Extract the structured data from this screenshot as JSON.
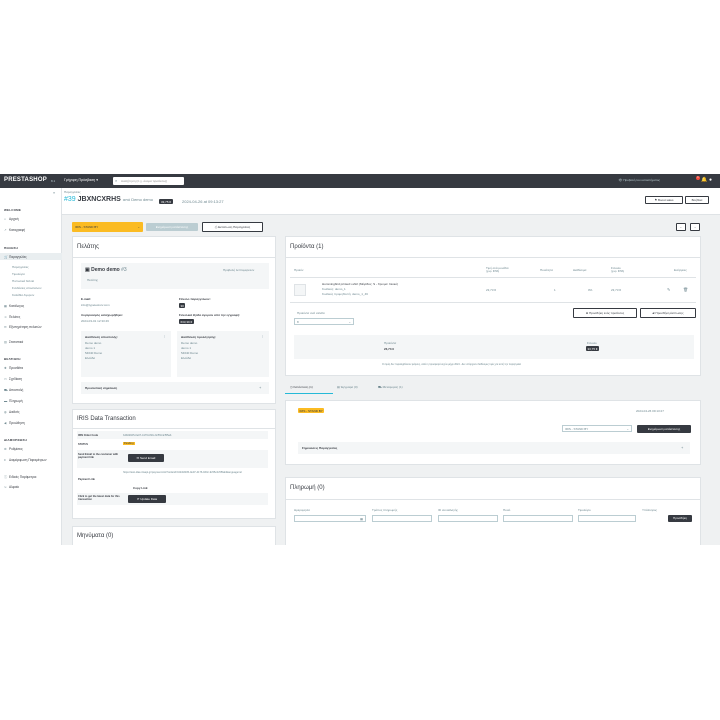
{
  "topbar": {
    "logo": "PRESTASHOP",
    "version": "8.1",
    "quick_access": "Γρήγορη Πρόσβαση ▾",
    "search_placeholder": "Αναζήτηση (π.χ. όνομα προϊόντος)",
    "view_shop": "Προβολή του καταστήματος",
    "notif_count": "1"
  },
  "sidebar": {
    "welcome_section": "WELCOME",
    "home": "Αρχική",
    "dashboard": "Καταγραφή",
    "sales_section": "ΠΩΛΗΣΗ",
    "orders": "Παραγγελίες",
    "orders_sub": [
      "Παραγγελίες",
      "Τιμολόγια",
      "Πιστωτικά δελτία",
      "Συνδέσεις αποστολών",
      "Καλάθια Αγορών"
    ],
    "catalog": "Κατάλογος",
    "customers": "Πελάτες",
    "support": "Εξυπηρέτηση πελατών",
    "stats": "Στατιστικά",
    "improve_section": "ΒΕΛΤΙΩΣΗ",
    "modules": "Προσθέτα",
    "design": "Σχεδίαση",
    "shipping": "Αποστολή",
    "payment": "Πληρωμή",
    "international": "Διεθνές",
    "marketing": "Προώθηση",
    "config_section": "ΔΙΑΜΟΡΦΩΣΗ",
    "settings": "Ρυθμίσεις",
    "shop_params": "Διαμόρφωση Παραμέτρων",
    "advanced": "Ειδικές Παράμετροι",
    "logout": "Αλφαίο"
  },
  "header": {
    "breadcrumb": "Παραγγελίες",
    "order_id": "#39",
    "order_ref": "JBXNCXRHS",
    "from": "από Demo demo",
    "total": "33,75 €",
    "date": "2024-04-26 at 09:13:27",
    "boost_sales": "Boost sales",
    "help": "Βοήθεια"
  },
  "actions": {
    "status_select": "IRIS - STAND BY",
    "update_status": "Ενημέρωση κατάστασης",
    "print_order": "Εκτύπωση Παραγγελίας"
  },
  "customer": {
    "title": "Πελάτης",
    "name": "Demo demo",
    "id": "#3",
    "view_profile": "Προβολή λεπτομερειών",
    "guest_label": "Πελάτης",
    "email_label": "E-mail:",
    "email": "info@typetestsrv.com",
    "validated_orders_label": "Σύνολο παραγγελιών:",
    "validated_orders": "30",
    "account_registered_label": "Λογαριασμός καταχωρήθηκε:",
    "account_registered": "2024-03-01 12:33:46",
    "total_spent_label": "Συνολικά έξοδα αγορών από την εγγραφή:",
    "total_spent": "633,39 €",
    "shipping_address_title": "Διεύθυνση αποστολής:",
    "shipping_address": [
      "Demo demo",
      "demo 1",
      "54640 Demo",
      "Ελλάδα"
    ],
    "invoice_address_title": "Διεύθυνση τιμολόγησης:",
    "invoice_address": [
      "Demo demo",
      "demo 1",
      "54640 Demo",
      "Ελλάδα"
    ],
    "private_note": "Προσωπική σημείωση"
  },
  "iris": {
    "title": "IRIS Data Transaction",
    "rows": [
      {
        "label": "IRIS Order Code",
        "value": "b4b02b05-0e07-4176-b60c-9c55c4c5f5ab"
      },
      {
        "label": "STATUS",
        "value": "Pending"
      },
      {
        "label": "Send Email to the customer with payment link",
        "value": "Send Email"
      },
      {
        "label": "Payment Link",
        "value": "https://test-dias.irisapi.gr/payment-link?orderid=b4b02b05-0e07-4176-b60c-9c55c4c5f5ab&language=el"
      },
      {
        "label": "Click to get the latest data for this transaction",
        "value": "Update Data"
      }
    ],
    "copy_link": "Copy Link"
  },
  "messages": {
    "title": "Μηνύματα (0)"
  },
  "products": {
    "title": "Προϊόντα (1)",
    "columns": [
      "Προϊόν",
      "Τιμή ανά μονάδα",
      "Ποσότητα",
      "Διαθέσιμα",
      "Σύνολο",
      "Ενέργειες"
    ],
    "col_sub": [
      "",
      "(χωρ. ΦΠΑ)",
      "",
      "",
      "(χωρ. ΦΠΑ)",
      ""
    ],
    "rows": [
      {
        "name": "Hummingbird printed t-shirt (Μέγεθος: S - Χρώμα: Λευκό)",
        "ref": "Κωδικός: demo_1",
        "supplier_ref": "Κωδικός προμηθευτή: demo_1_46",
        "price": "23,73 €",
        "qty": "1",
        "available": "0%",
        "total": "23,73 €"
      }
    ],
    "add_product": "Προσθήκη ενός προϊόντος",
    "add_discount": "Προσθήκη έκπτωσης",
    "per_page_label": "Προϊόντα ανά σελίδα",
    "per_page": "8",
    "summary_products_label": "Προϊόντα",
    "summary_products": "23,73 €",
    "summary_total_label": "Σύνολο",
    "summary_total": "33,75 €",
    "tax_note": "Οι τιμές δεν περιλαμβάνουν φόρους, αλλά η προσφορά ισχύει μέχρι 2024 · Δεν υπάρχουν διαθέσιμες τιμές για αυτή την παραγγελία"
  },
  "tabs": {
    "status": "Κατάσταση (1)",
    "documents": "Έγγραφα (0)",
    "shipping": "Μεταφορείς (1)"
  },
  "status_panel": {
    "badge": "IRIS - STAND BY",
    "date": "2024-04-26 09:13:27",
    "select": "IRIS - STAND BY",
    "update": "Ενημέρωση κατάστασης",
    "order_note": "Σημειώσεις Παραγγελίας"
  },
  "payment": {
    "title": "Πληρωμή (0)",
    "columns": [
      "Ημερομηνία",
      "Τρόπος πληρωμής",
      "ID συναλλαγής",
      "Ποσό",
      "Τιμολόγιο",
      "Υπάλληλος"
    ],
    "add_button": "Προσθήκη"
  }
}
